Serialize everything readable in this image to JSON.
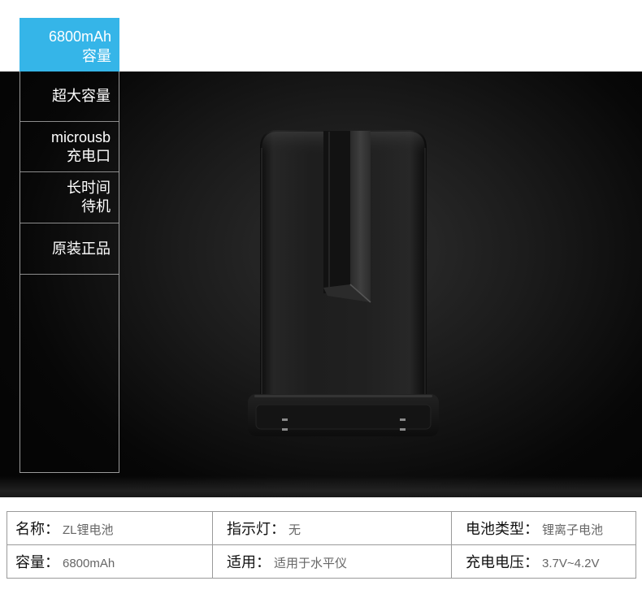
{
  "colors": {
    "accent": "#35b5e8",
    "dark_background": "#070707",
    "label_text": "#111111",
    "value_text": "#666666"
  },
  "tab": {
    "line1": "6800mAh",
    "line2": "容量"
  },
  "menu": {
    "items": [
      {
        "line1": "超大容量"
      },
      {
        "line1": "microusb",
        "line2": "充电口"
      },
      {
        "line1": "长时间",
        "line2": "待机"
      },
      {
        "line1": "原装正品"
      }
    ]
  },
  "specs": {
    "rows": [
      [
        {
          "label": "名称：",
          "value": "ZL锂电池"
        },
        {
          "label": "指示灯：",
          "value": "无"
        },
        {
          "label": "电池类型：",
          "value": "锂离子电池"
        }
      ],
      [
        {
          "label": "容量：",
          "value": "6800mAh"
        },
        {
          "label": "适用：",
          "value": "适用于水平仪"
        },
        {
          "label": "充电电压：",
          "value": "3.7V~4.2V"
        }
      ]
    ]
  }
}
